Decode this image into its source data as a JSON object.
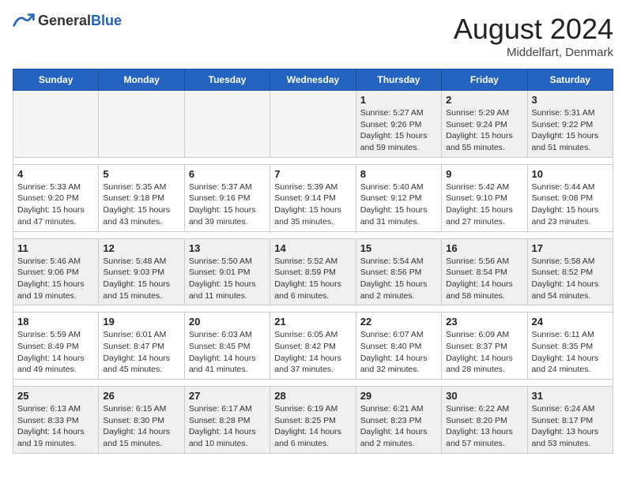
{
  "header": {
    "logo_general": "General",
    "logo_blue": "Blue",
    "month_year": "August 2024",
    "location": "Middelfart, Denmark"
  },
  "weekdays": [
    "Sunday",
    "Monday",
    "Tuesday",
    "Wednesday",
    "Thursday",
    "Friday",
    "Saturday"
  ],
  "weeks": [
    [
      {
        "day": "",
        "empty": true
      },
      {
        "day": "",
        "empty": true
      },
      {
        "day": "",
        "empty": true
      },
      {
        "day": "",
        "empty": true
      },
      {
        "day": "1",
        "sunrise": "5:27 AM",
        "sunset": "9:26 PM",
        "daylight": "15 hours and 59 minutes."
      },
      {
        "day": "2",
        "sunrise": "5:29 AM",
        "sunset": "9:24 PM",
        "daylight": "15 hours and 55 minutes."
      },
      {
        "day": "3",
        "sunrise": "5:31 AM",
        "sunset": "9:22 PM",
        "daylight": "15 hours and 51 minutes."
      }
    ],
    [
      {
        "day": "4",
        "sunrise": "5:33 AM",
        "sunset": "9:20 PM",
        "daylight": "15 hours and 47 minutes."
      },
      {
        "day": "5",
        "sunrise": "5:35 AM",
        "sunset": "9:18 PM",
        "daylight": "15 hours and 43 minutes."
      },
      {
        "day": "6",
        "sunrise": "5:37 AM",
        "sunset": "9:16 PM",
        "daylight": "15 hours and 39 minutes."
      },
      {
        "day": "7",
        "sunrise": "5:39 AM",
        "sunset": "9:14 PM",
        "daylight": "15 hours and 35 minutes."
      },
      {
        "day": "8",
        "sunrise": "5:40 AM",
        "sunset": "9:12 PM",
        "daylight": "15 hours and 31 minutes."
      },
      {
        "day": "9",
        "sunrise": "5:42 AM",
        "sunset": "9:10 PM",
        "daylight": "15 hours and 27 minutes."
      },
      {
        "day": "10",
        "sunrise": "5:44 AM",
        "sunset": "9:08 PM",
        "daylight": "15 hours and 23 minutes."
      }
    ],
    [
      {
        "day": "11",
        "sunrise": "5:46 AM",
        "sunset": "9:06 PM",
        "daylight": "15 hours and 19 minutes."
      },
      {
        "day": "12",
        "sunrise": "5:48 AM",
        "sunset": "9:03 PM",
        "daylight": "15 hours and 15 minutes."
      },
      {
        "day": "13",
        "sunrise": "5:50 AM",
        "sunset": "9:01 PM",
        "daylight": "15 hours and 11 minutes."
      },
      {
        "day": "14",
        "sunrise": "5:52 AM",
        "sunset": "8:59 PM",
        "daylight": "15 hours and 6 minutes."
      },
      {
        "day": "15",
        "sunrise": "5:54 AM",
        "sunset": "8:56 PM",
        "daylight": "15 hours and 2 minutes."
      },
      {
        "day": "16",
        "sunrise": "5:56 AM",
        "sunset": "8:54 PM",
        "daylight": "14 hours and 58 minutes."
      },
      {
        "day": "17",
        "sunrise": "5:58 AM",
        "sunset": "8:52 PM",
        "daylight": "14 hours and 54 minutes."
      }
    ],
    [
      {
        "day": "18",
        "sunrise": "5:59 AM",
        "sunset": "8:49 PM",
        "daylight": "14 hours and 49 minutes."
      },
      {
        "day": "19",
        "sunrise": "6:01 AM",
        "sunset": "8:47 PM",
        "daylight": "14 hours and 45 minutes."
      },
      {
        "day": "20",
        "sunrise": "6:03 AM",
        "sunset": "8:45 PM",
        "daylight": "14 hours and 41 minutes."
      },
      {
        "day": "21",
        "sunrise": "6:05 AM",
        "sunset": "8:42 PM",
        "daylight": "14 hours and 37 minutes."
      },
      {
        "day": "22",
        "sunrise": "6:07 AM",
        "sunset": "8:40 PM",
        "daylight": "14 hours and 32 minutes."
      },
      {
        "day": "23",
        "sunrise": "6:09 AM",
        "sunset": "8:37 PM",
        "daylight": "14 hours and 28 minutes."
      },
      {
        "day": "24",
        "sunrise": "6:11 AM",
        "sunset": "8:35 PM",
        "daylight": "14 hours and 24 minutes."
      }
    ],
    [
      {
        "day": "25",
        "sunrise": "6:13 AM",
        "sunset": "8:33 PM",
        "daylight": "14 hours and 19 minutes."
      },
      {
        "day": "26",
        "sunrise": "6:15 AM",
        "sunset": "8:30 PM",
        "daylight": "14 hours and 15 minutes."
      },
      {
        "day": "27",
        "sunrise": "6:17 AM",
        "sunset": "8:28 PM",
        "daylight": "14 hours and 10 minutes."
      },
      {
        "day": "28",
        "sunrise": "6:19 AM",
        "sunset": "8:25 PM",
        "daylight": "14 hours and 6 minutes."
      },
      {
        "day": "29",
        "sunrise": "6:21 AM",
        "sunset": "8:23 PM",
        "daylight": "14 hours and 2 minutes."
      },
      {
        "day": "30",
        "sunrise": "6:22 AM",
        "sunset": "8:20 PM",
        "daylight": "13 hours and 57 minutes."
      },
      {
        "day": "31",
        "sunrise": "6:24 AM",
        "sunset": "8:17 PM",
        "daylight": "13 hours and 53 minutes."
      }
    ]
  ],
  "labels": {
    "sunrise": "Sunrise:",
    "sunset": "Sunset:",
    "daylight": "Daylight:"
  }
}
